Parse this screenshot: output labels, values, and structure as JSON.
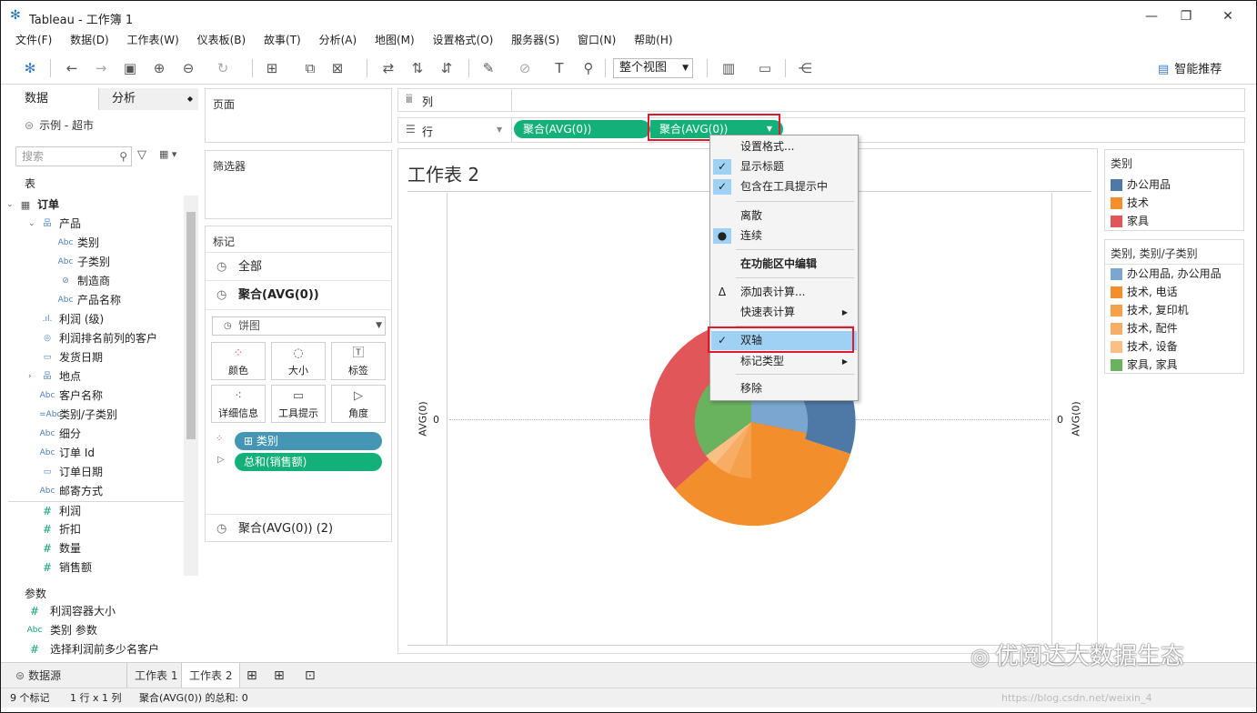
{
  "window": {
    "title": "Tableau - 工作簿 1"
  },
  "menubar": [
    "文件(F)",
    "数据(D)",
    "工作表(W)",
    "仪表板(B)",
    "故事(T)",
    "分析(A)",
    "地图(M)",
    "设置格式(O)",
    "服务器(S)",
    "窗口(N)",
    "帮助(H)"
  ],
  "toolbar": {
    "fit_label": "整个视图",
    "smart_label": "智能推荐"
  },
  "datapane": {
    "tab_data": "数据",
    "tab_analysis": "分析",
    "datasource": "示例 - 超市",
    "search_placeholder": "搜索",
    "section_tables": "表",
    "fields": [
      {
        "icon": "table-icon",
        "glyph": "▦",
        "label": "订单",
        "indent": 0,
        "bold": true
      },
      {
        "icon": "hierarchy-icon",
        "glyph": "品",
        "label": "产品",
        "indent": 1
      },
      {
        "icon": "string-icon",
        "glyph": "Abc",
        "label": "类别",
        "indent": 2
      },
      {
        "icon": "string-icon",
        "glyph": "Abc",
        "label": "子类别",
        "indent": 2
      },
      {
        "icon": "clip-icon",
        "glyph": "⊘",
        "label": "制造商",
        "indent": 2
      },
      {
        "icon": "string-icon",
        "glyph": "Abc",
        "label": "产品名称",
        "indent": 2
      },
      {
        "icon": "bin-icon",
        "glyph": ".ıl.",
        "label": "利润 (级)",
        "indent": 1
      },
      {
        "icon": "set-icon",
        "glyph": "◎",
        "label": "利润排名前列的客户",
        "indent": 1
      },
      {
        "icon": "date-icon",
        "glyph": "▭",
        "label": "发货日期",
        "indent": 1
      },
      {
        "icon": "hierarchy-icon",
        "glyph": "品",
        "label": "地点",
        "indent": 1
      },
      {
        "icon": "string-icon",
        "glyph": "Abc",
        "label": "客户名称",
        "indent": 1
      },
      {
        "icon": "string-icon",
        "glyph": "=Abc",
        "label": "类别/子类别",
        "indent": 1
      },
      {
        "icon": "string-icon",
        "glyph": "Abc",
        "label": "细分",
        "indent": 1
      },
      {
        "icon": "string-icon",
        "glyph": "Abc",
        "label": "订单 Id",
        "indent": 1
      },
      {
        "icon": "date-icon",
        "glyph": "▭",
        "label": "订单日期",
        "indent": 1
      },
      {
        "icon": "string-icon",
        "glyph": "Abc",
        "label": "邮寄方式",
        "indent": 1
      },
      {
        "icon": "measure-icon",
        "glyph": "#",
        "label": "利润",
        "indent": 1
      },
      {
        "icon": "measure-icon",
        "glyph": "#",
        "label": "折扣",
        "indent": 1
      },
      {
        "icon": "measure-icon",
        "glyph": "#",
        "label": "数量",
        "indent": 1
      },
      {
        "icon": "measure-icon",
        "glyph": "#",
        "label": "销售额",
        "indent": 1
      }
    ],
    "section_params": "参数",
    "params": [
      {
        "glyph": "#",
        "label": "利润容器大小"
      },
      {
        "glyph": "Abc",
        "label": "类别 参数"
      },
      {
        "glyph": "#",
        "label": "选择利润前多少名客户"
      }
    ]
  },
  "shelves": {
    "pages": "页面",
    "filters": "筛选器",
    "columns": "列",
    "rows": "行",
    "row_pill_1": "聚合(AVG(0))",
    "row_pill_2": "聚合(AVG(0))"
  },
  "marks": {
    "header": "标记",
    "all": "全部",
    "item1": "聚合(AVG(0))",
    "type": "饼图",
    "buttons": [
      "颜色",
      "大小",
      "标签",
      "详细信息",
      "工具提示",
      "角度"
    ],
    "pill_color": "类别",
    "pill_angle": "总和(销售额)",
    "item2": "聚合(AVG(0)) (2)"
  },
  "view": {
    "sheet_title": "工作表 2",
    "axis_left_label": "AVG(0)",
    "axis_right_label": "AVG(0)",
    "axis_left_tick": "0",
    "axis_right_tick": "0"
  },
  "legend1": {
    "title": "类别",
    "items": [
      {
        "label": "办公用品",
        "color": "#4e79a7"
      },
      {
        "label": "技术",
        "color": "#f28e2b"
      },
      {
        "label": "家具",
        "color": "#e15759"
      }
    ]
  },
  "legend2": {
    "title": "类别, 类别/子类别",
    "items": [
      {
        "label": "办公用品, 办公用品",
        "color": "#7aa6cf"
      },
      {
        "label": "技术, 电话",
        "color": "#f28e2b"
      },
      {
        "label": "技术, 复印机",
        "color": "#f5a04a"
      },
      {
        "label": "技术, 配件",
        "color": "#f7ad66"
      },
      {
        "label": "技术, 设备",
        "color": "#fabf85"
      },
      {
        "label": "家具, 家具",
        "color": "#6ab35e"
      }
    ]
  },
  "context_menu": {
    "items": [
      {
        "label": "设置格式...",
        "check": ""
      },
      {
        "label": "显示标题",
        "check": "✓"
      },
      {
        "label": "包含在工具提示中",
        "check": "✓"
      },
      {
        "label": "离散",
        "check": ""
      },
      {
        "label": "连续",
        "check": "●"
      },
      {
        "label": "在功能区中编辑",
        "check": "",
        "bold": true
      },
      {
        "label": "添加表计算...",
        "check": "Δ"
      },
      {
        "label": "快速表计算",
        "check": "",
        "submenu": true
      },
      {
        "label": "双轴",
        "check": "✓",
        "highlight": true
      },
      {
        "label": "标记类型",
        "check": "",
        "submenu": true
      },
      {
        "label": "移除",
        "check": ""
      }
    ]
  },
  "bottom_tabs": [
    "数据源",
    "工作表 1",
    "工作表 2"
  ],
  "status": {
    "marks": "9 个标记",
    "rows_cols": "1 行 x 1 列",
    "sum": "聚合(AVG(0)) 的总和: 0"
  },
  "watermark": "优阅达大数据生态",
  "watermark_url": "https://blog.csdn.net/weixin_4"
}
